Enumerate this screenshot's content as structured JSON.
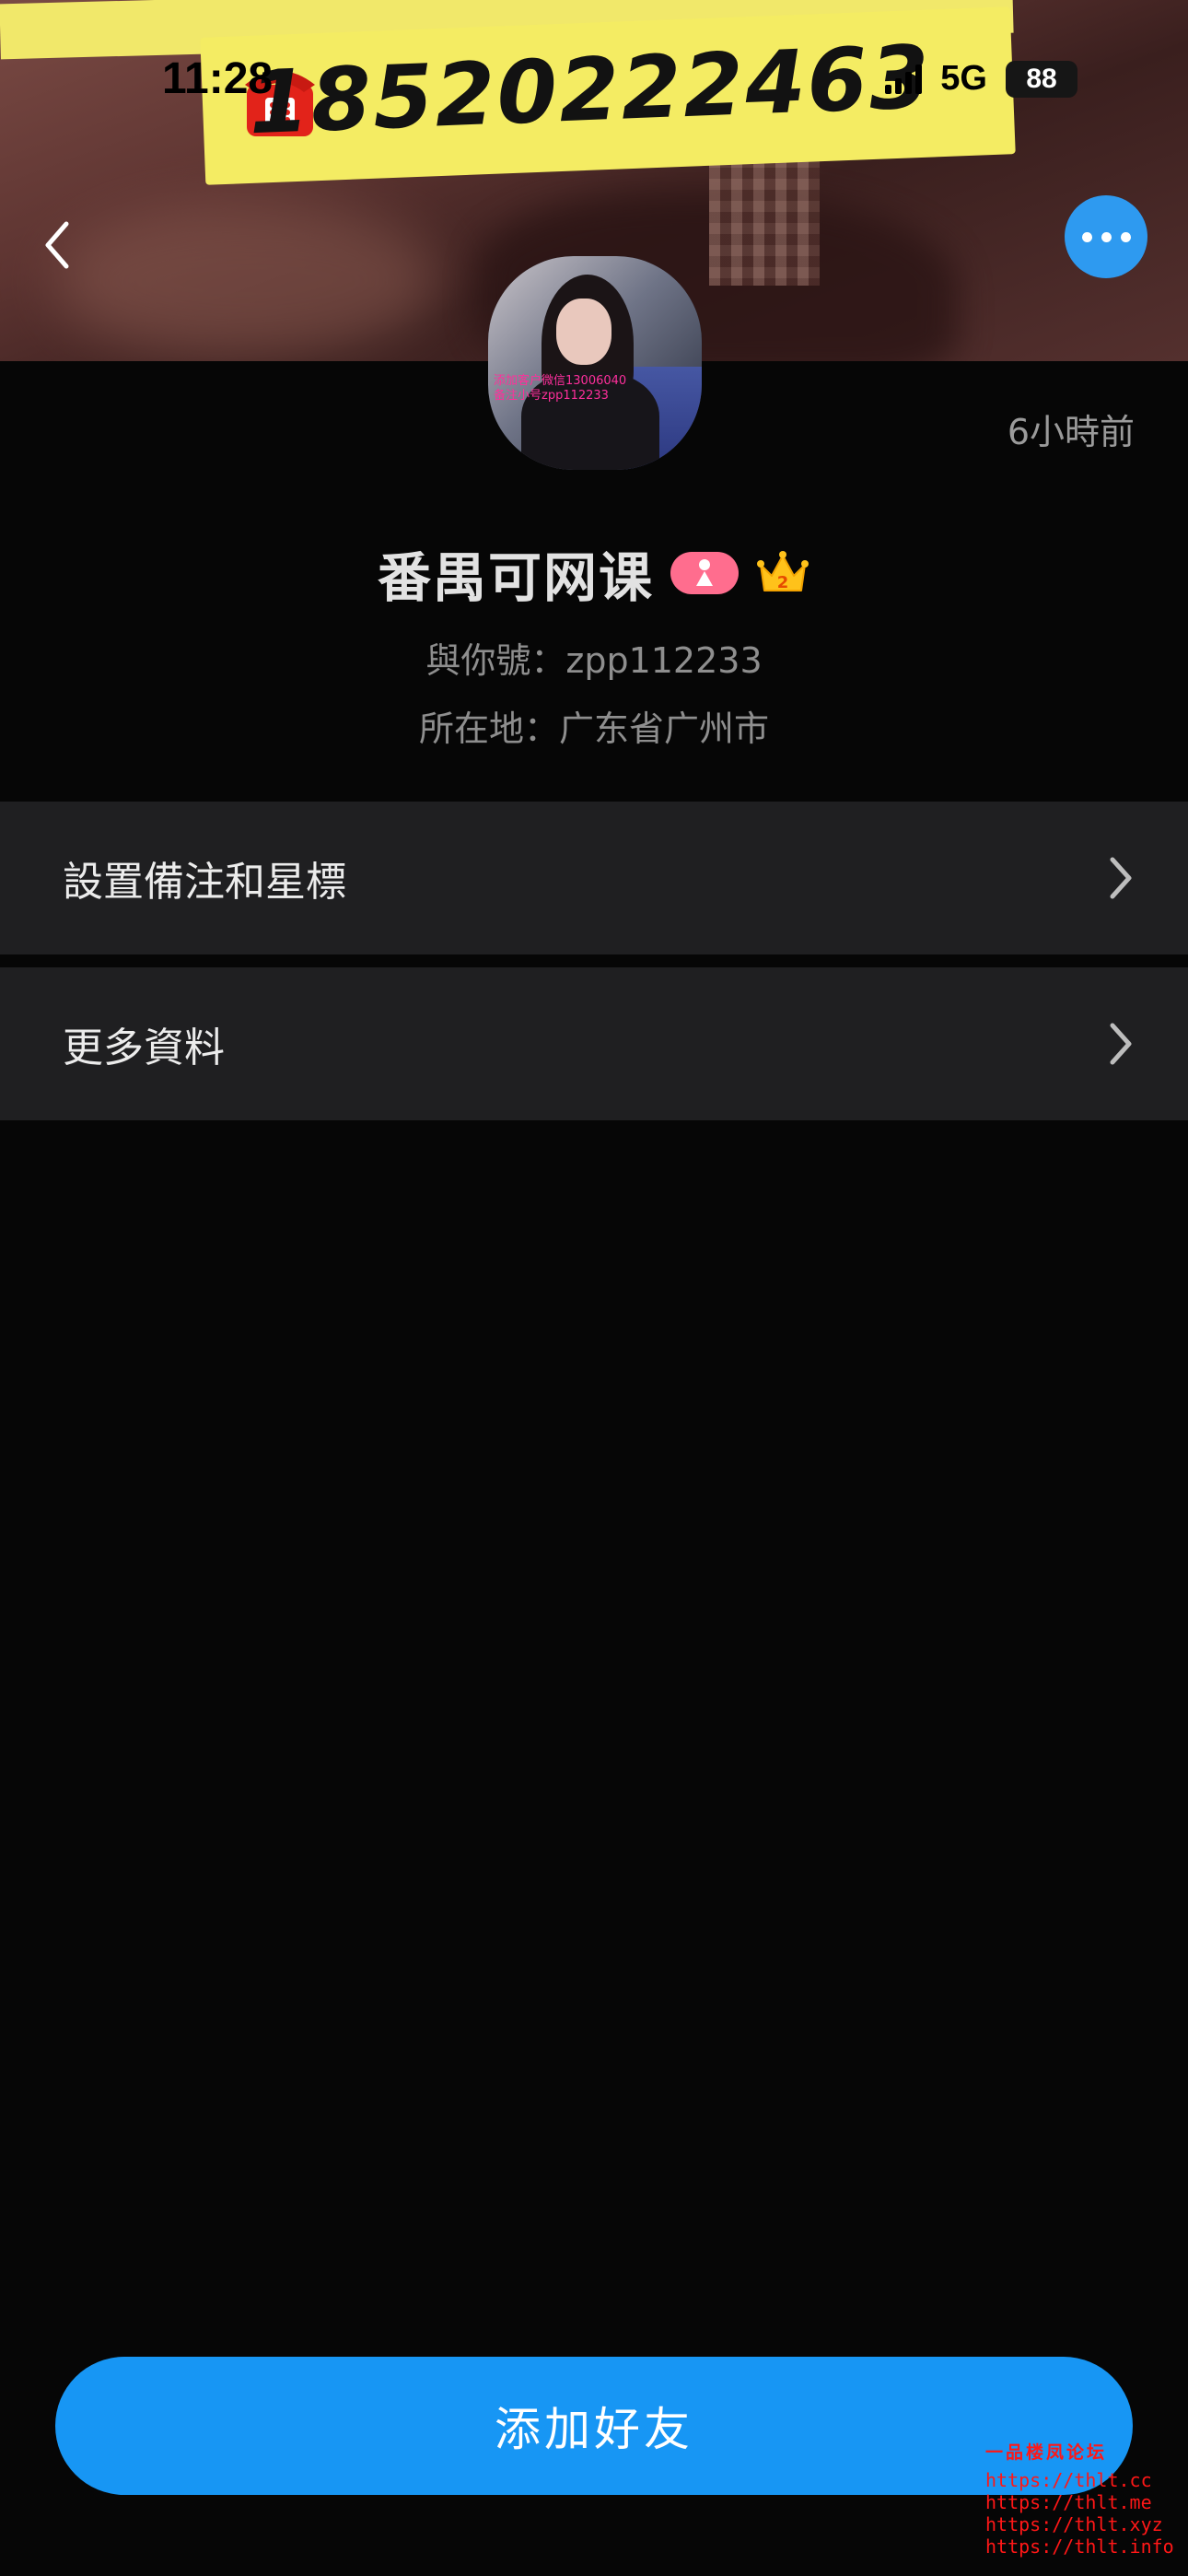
{
  "status_bar": {
    "time": "11:28",
    "network": "5G",
    "battery": "88"
  },
  "cover_banner": {
    "phone_number": "18520222463"
  },
  "header": {
    "back_icon": "chevron-left-icon",
    "more_icon": "more-horizontal-icon",
    "more_button_color": "#2e9af0"
  },
  "avatar": {
    "watermark_line1": "添加客户微信13006040",
    "watermark_line2": "备注小号zpp112233"
  },
  "profile": {
    "timestamp": "6小時前",
    "name": "番禺可网课",
    "gender_icon": "female-icon",
    "gender_badge_color": "#ff6d8e",
    "level_icon": "crown-icon",
    "level_value": "2",
    "id_line": "與你號：zpp112233",
    "location_line": "所在地：广东省广州市"
  },
  "menu": [
    {
      "label": "設置備注和星標",
      "icon": "chevron-right-icon"
    },
    {
      "label": "更多資料",
      "icon": "chevron-right-icon"
    }
  ],
  "primary_action": {
    "label": "添加好友",
    "color": "#1796f4"
  },
  "forum_watermark": {
    "title": "一品楼凤论坛",
    "lines": [
      "https://thlt.cc",
      "https://thlt.me",
      "https://thlt.xyz",
      "https://thlt.info"
    ]
  }
}
